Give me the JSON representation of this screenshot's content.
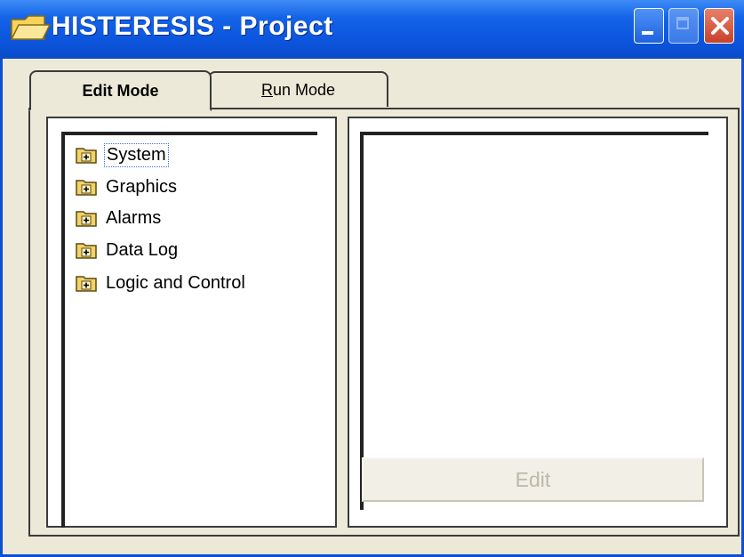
{
  "window": {
    "title": "HISTERESIS - Project",
    "title_icon": "open-folder-icon",
    "controls": [
      "minimize-icon",
      "maximize-icon",
      "close-icon"
    ]
  },
  "tabs": [
    {
      "label": "Edit Mode",
      "active": true
    },
    {
      "label_prefix": "R",
      "label_rest": "un Mode",
      "active": false
    }
  ],
  "tree": {
    "items": [
      {
        "label": "System",
        "icon": "folder-plus-icon",
        "selected": true
      },
      {
        "label": "Graphics",
        "icon": "folder-plus-icon",
        "selected": false
      },
      {
        "label": "Alarms",
        "icon": "folder-plus-icon",
        "selected": false
      },
      {
        "label": "Data Log",
        "icon": "folder-plus-icon",
        "selected": false
      },
      {
        "label": "Logic and Control",
        "icon": "folder-plus-icon",
        "selected": false
      }
    ]
  },
  "right_panel": {
    "edit_button_label": "Edit",
    "edit_button_enabled": false
  },
  "colors": {
    "titlebar": "#0b55dd",
    "window_bg": "#ece9d8",
    "folder": "#f2d36a"
  }
}
